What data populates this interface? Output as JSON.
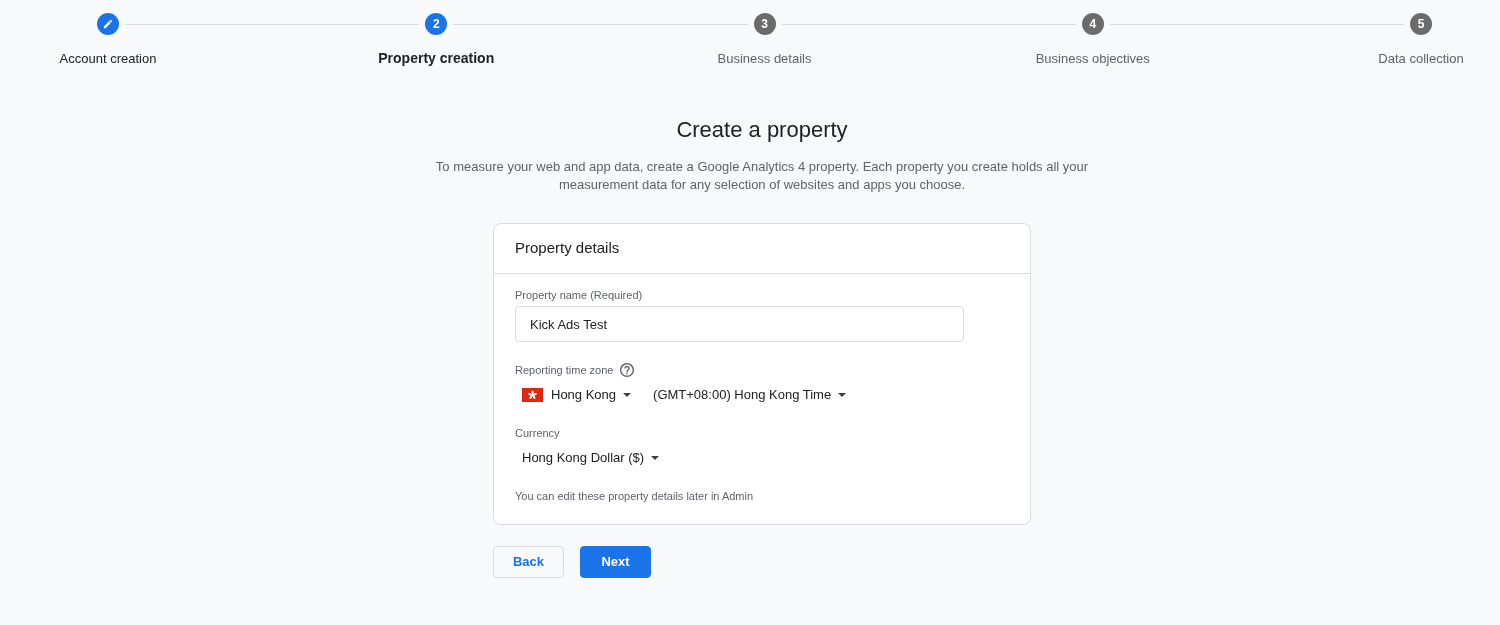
{
  "steps": [
    {
      "label": "Account creation",
      "completed": true,
      "selected": false
    },
    {
      "number": "2",
      "label": "Property creation",
      "completed": false,
      "selected": true
    },
    {
      "number": "3",
      "label": "Business details",
      "completed": false,
      "selected": false
    },
    {
      "number": "4",
      "label": "Business objectives",
      "completed": false,
      "selected": false
    },
    {
      "number": "5",
      "label": "Data collection",
      "completed": false,
      "selected": false
    }
  ],
  "heading": "Create a property",
  "description": "To measure your web and app data, create a Google Analytics 4 property. Each property you create holds all your measurement data for any selection of websites and apps you choose.",
  "card": {
    "title": "Property details",
    "fields": [
      {
        "kind": "text",
        "label": "Property name (Required)",
        "value": "Kick Ads Test"
      },
      {
        "kind": "timezone",
        "label": "Reporting time zone",
        "help": true,
        "country": "Hong Kong",
        "timezone": "(GMT+08:00) Hong Kong Time"
      },
      {
        "kind": "select",
        "label": "Currency",
        "value": "Hong Kong Dollar ($)"
      }
    ],
    "note": "You can edit these property details later in Admin"
  },
  "buttons": [
    {
      "kind": "secondary",
      "label": "Back"
    },
    {
      "kind": "primary",
      "label": "Next"
    }
  ]
}
